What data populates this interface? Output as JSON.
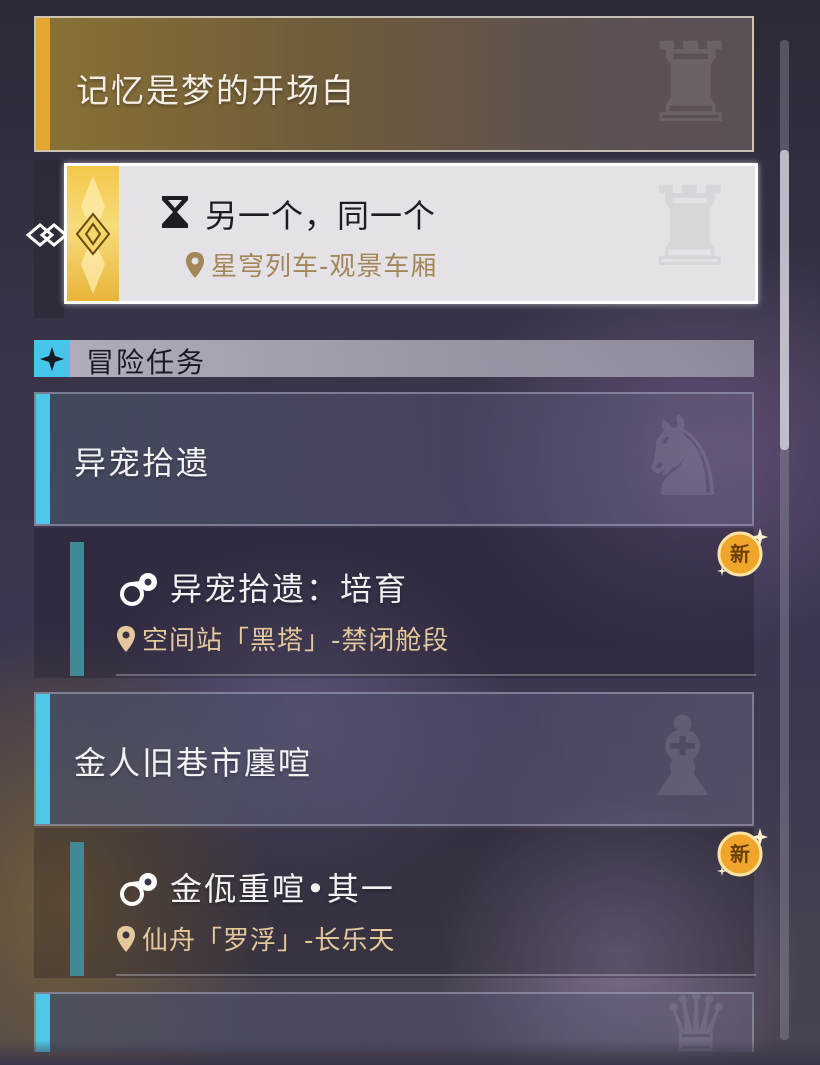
{
  "main_quest": {
    "header_title": "记忆是梦的开场白",
    "selected": {
      "title": "另一个，同一个",
      "location": "星穹列车-观景车厢",
      "icon": "hourglass-icon"
    }
  },
  "section": {
    "label": "冒险任务",
    "icon": "star-icon"
  },
  "groups": [
    {
      "label": "异宠拾遗",
      "quests": [
        {
          "title": "异宠拾遗：培育",
          "location": "空间站「黑塔」-禁闭舱段",
          "badge": "新",
          "icon": "adventure-quest-icon"
        }
      ]
    },
    {
      "label": "金人旧巷市廛喧",
      "quests": [
        {
          "title": "金佤重喧•其一",
          "location": "仙舟「罗浮」-长乐天",
          "badge": "新",
          "icon": "adventure-quest-icon"
        }
      ]
    }
  ],
  "colors": {
    "main_accent": "#e3a534",
    "adventure_accent": "#4fc7e6",
    "location_text": "#e4c79a",
    "selected_location_text": "#a38758",
    "badge": "#f0a62a"
  }
}
